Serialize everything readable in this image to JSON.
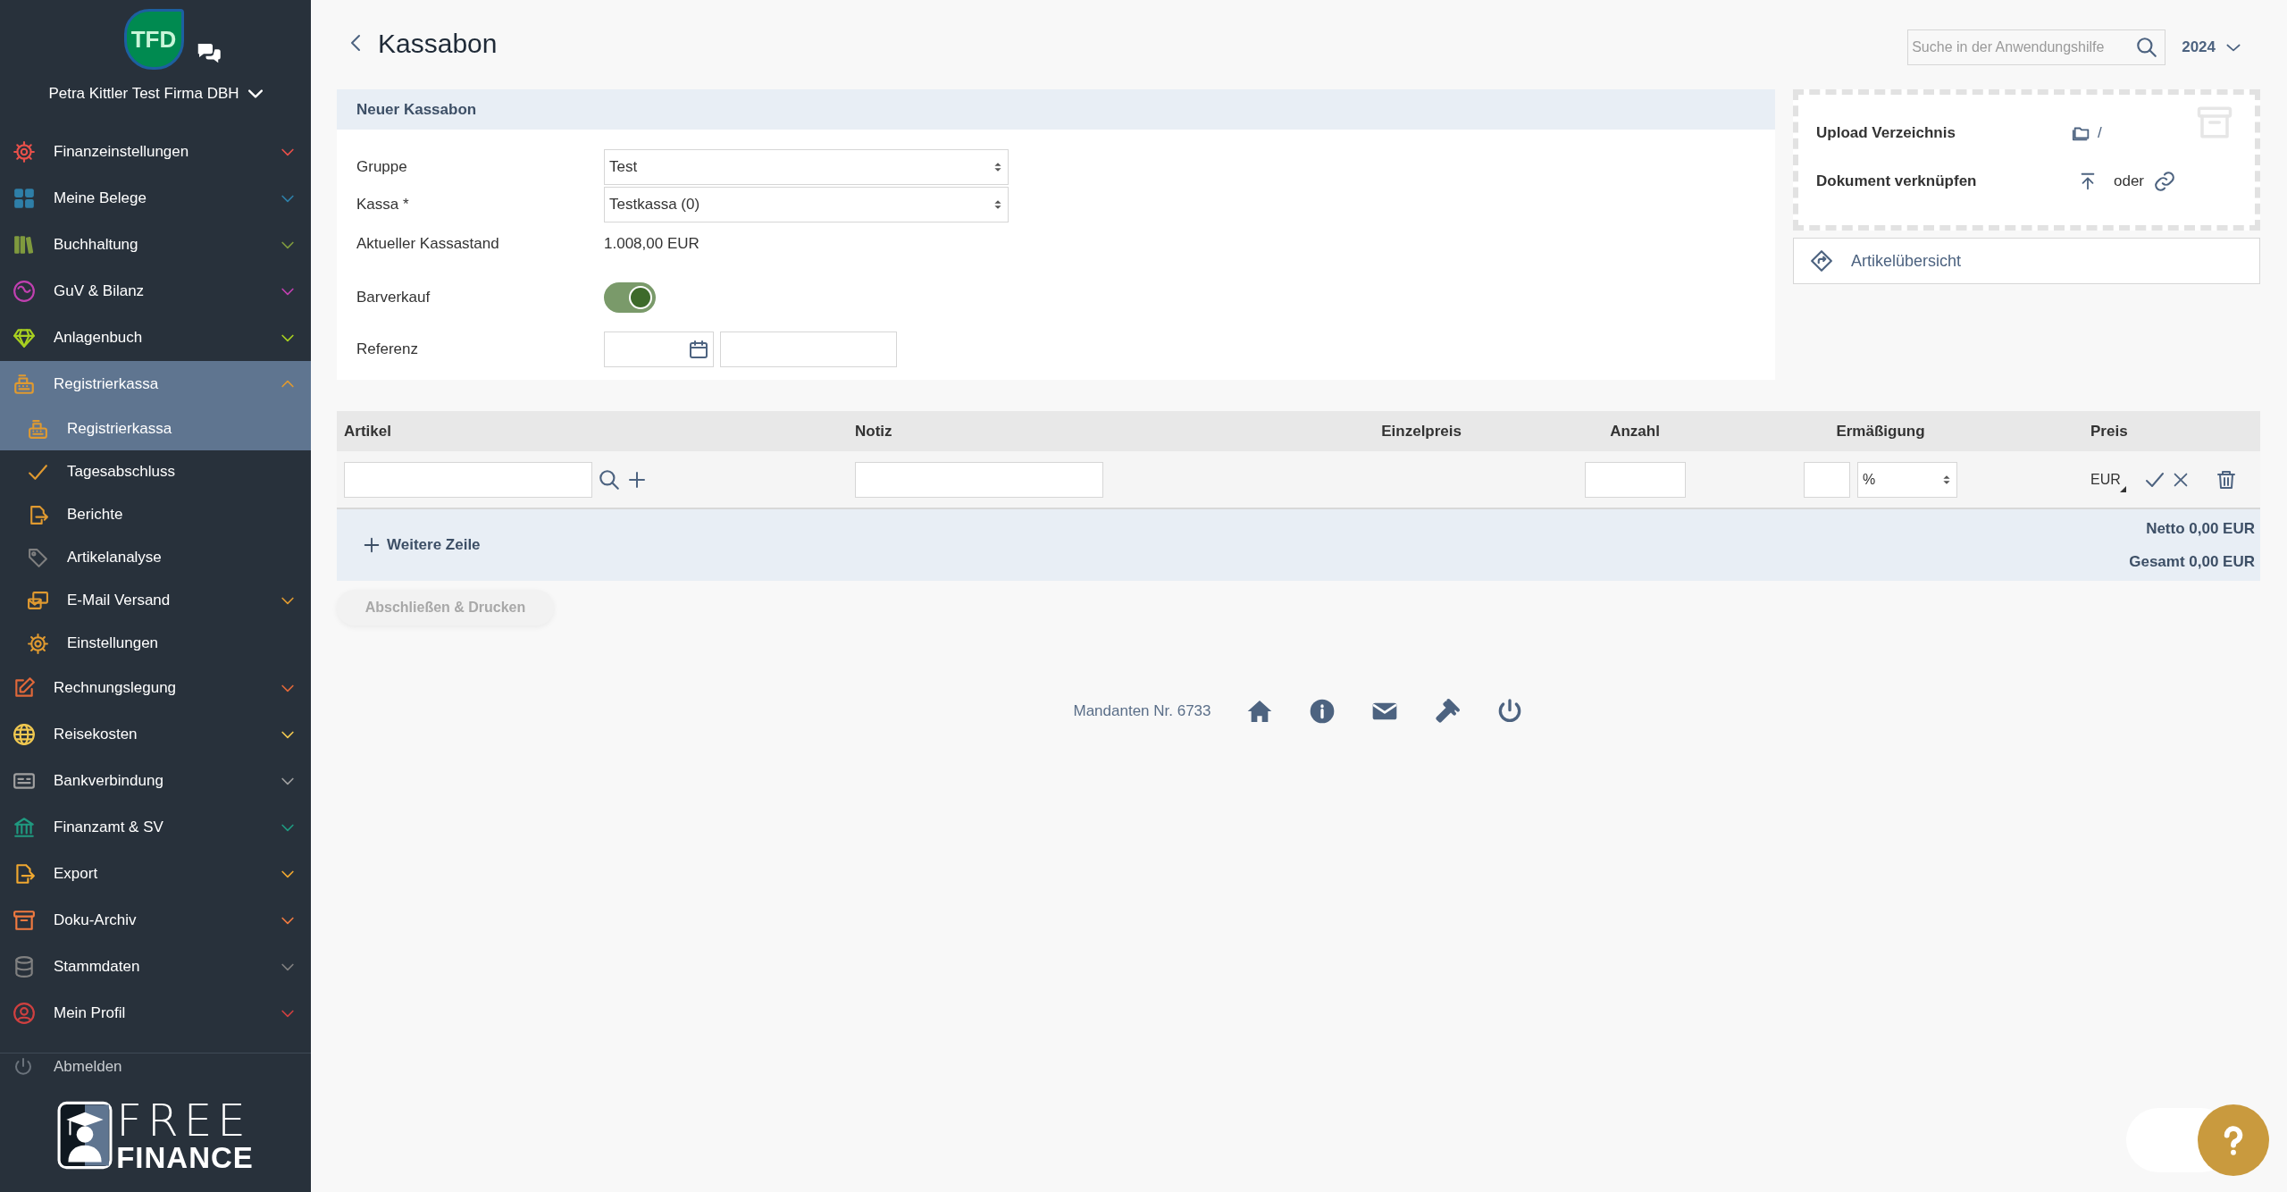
{
  "sidebar": {
    "badge": "TFD",
    "company": "Petra Kittler Test Firma DBH",
    "items": [
      {
        "label": "Finanzeinstellungen",
        "color": "#e8504a",
        "expanded": false,
        "selected": false
      },
      {
        "label": "Meine Belege",
        "color": "#2e7fa8",
        "expanded": false,
        "selected": false
      },
      {
        "label": "Buchhaltung",
        "color": "#7f9a3e",
        "expanded": false,
        "selected": false
      },
      {
        "label": "GuV & Bilanz",
        "color": "#c040b0",
        "expanded": false,
        "selected": false
      },
      {
        "label": "Anlagenbuch",
        "color": "#a8d020",
        "expanded": false,
        "selected": false
      },
      {
        "label": "Registrierkassa",
        "color": "#e09a30",
        "expanded": true,
        "selected": true,
        "children": [
          {
            "label": "Registrierkassa",
            "color": "#e09a30",
            "kind": "link",
            "selected": true
          },
          {
            "label": "Tagesabschluss",
            "color": "#e09a30",
            "kind": "link",
            "selected": false
          },
          {
            "label": "Berichte",
            "color": "#e09a30",
            "kind": "link",
            "selected": false
          },
          {
            "label": "Artikelanalyse",
            "color": "#808080",
            "kind": "link",
            "selected": false
          },
          {
            "label": "E-Mail Versand",
            "color": "#e09a30",
            "kind": "group",
            "selected": false
          },
          {
            "label": "Einstellungen",
            "color": "#e09a30",
            "kind": "link",
            "selected": false
          }
        ]
      },
      {
        "label": "Rechnungslegung",
        "color": "#e0683a",
        "expanded": false,
        "selected": false
      },
      {
        "label": "Reisekosten",
        "color": "#f0c850",
        "expanded": false,
        "selected": false
      },
      {
        "label": "Bankverbindung",
        "color": "#a0a0a0",
        "expanded": false,
        "selected": false
      },
      {
        "label": "Finanzamt & SV",
        "color": "#1f9a80",
        "expanded": false,
        "selected": false
      },
      {
        "label": "Export",
        "color": "#f0a830",
        "expanded": false,
        "selected": false
      },
      {
        "label": "Doku-Archiv",
        "color": "#f07a40",
        "expanded": false,
        "selected": false
      },
      {
        "label": "Stammdaten",
        "color": "#808080",
        "expanded": false,
        "selected": false
      },
      {
        "label": "Mein Profil",
        "color": "#d04040",
        "expanded": false,
        "selected": false
      }
    ],
    "logout": "Abmelden",
    "brand_top": "FREE",
    "brand_bottom": "FINANCE"
  },
  "page": {
    "title": "Kassabon",
    "search": {
      "placeholder": "Suche in der Anwendungshilfe"
    },
    "year": "2024"
  },
  "form": {
    "title": "Neuer Kassabon",
    "fields": [
      {
        "kind": "select",
        "label": "Gruppe",
        "value": "Test"
      },
      {
        "kind": "select",
        "label": "Kassa *",
        "value": "Testkassa (0)"
      },
      {
        "kind": "text",
        "label": "Aktueller Kassastand",
        "value": "1.008,00 EUR"
      },
      {
        "kind": "toggle",
        "label": "Barverkauf",
        "on": true
      },
      {
        "kind": "reference",
        "label": "Referenz"
      }
    ]
  },
  "upload": {
    "rows": [
      {
        "kind": "folder",
        "label": "Upload Verzeichnis",
        "text": "/"
      },
      {
        "kind": "link",
        "label": "Dokument verknüpfen",
        "text": "oder"
      }
    ],
    "article_overview": "Artikelübersicht"
  },
  "table": {
    "columns": [
      "Artikel",
      "Notiz",
      "Einzelpreis",
      "Anzahl",
      "Ermäßigung",
      "Preis"
    ],
    "row": {
      "discount_unit": "%",
      "currency": "EUR"
    },
    "add_row": "Weitere Zeile",
    "net": "Netto 0,00 EUR",
    "total": "Gesamt 0,00 EUR"
  },
  "submit": {
    "label": "Abschließen & Drucken",
    "disabled": true
  },
  "footer": {
    "client": "Mandanten Nr. 6733"
  }
}
